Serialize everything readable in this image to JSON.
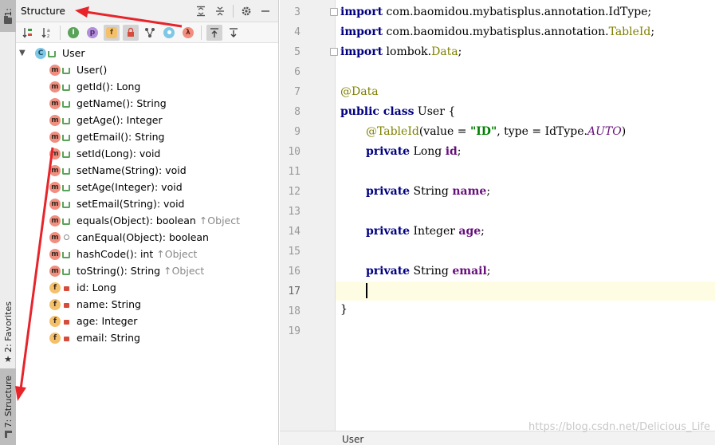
{
  "side_strip": {
    "project_tab": "1:",
    "favorites_tab": "2: Favorites",
    "structure_tab": "7: Structure"
  },
  "structure_panel": {
    "title": "Structure",
    "toolbar_icons": [
      "sort-visibility-icon",
      "sort-alpha-icon",
      "show-inherited-icon",
      "show-properties-icon",
      "show-fields-icon",
      "show-non-public-icon",
      "show-lambdas-icon",
      "autoscroll-to-source-icon",
      "autoscroll-from-source-icon"
    ],
    "root": "User",
    "members": [
      {
        "kind": "m",
        "vis": "public",
        "name": "User()",
        "override": ""
      },
      {
        "kind": "m",
        "vis": "public",
        "name": "getId(): Long",
        "override": ""
      },
      {
        "kind": "m",
        "vis": "public",
        "name": "getName(): String",
        "override": ""
      },
      {
        "kind": "m",
        "vis": "public",
        "name": "getAge(): Integer",
        "override": ""
      },
      {
        "kind": "m",
        "vis": "public",
        "name": "getEmail(): String",
        "override": ""
      },
      {
        "kind": "m",
        "vis": "public",
        "name": "setId(Long): void",
        "override": ""
      },
      {
        "kind": "m",
        "vis": "public",
        "name": "setName(String): void",
        "override": ""
      },
      {
        "kind": "m",
        "vis": "public",
        "name": "setAge(Integer): void",
        "override": ""
      },
      {
        "kind": "m",
        "vis": "public",
        "name": "setEmail(String): void",
        "override": ""
      },
      {
        "kind": "m",
        "vis": "public",
        "name": "equals(Object): boolean",
        "override": "↑Object"
      },
      {
        "kind": "m",
        "vis": "package",
        "name": "canEqual(Object): boolean",
        "override": ""
      },
      {
        "kind": "m",
        "vis": "public",
        "name": "hashCode(): int",
        "override": "↑Object"
      },
      {
        "kind": "m",
        "vis": "public",
        "name": "toString(): String",
        "override": "↑Object"
      },
      {
        "kind": "f",
        "vis": "private",
        "name": "id: Long",
        "override": ""
      },
      {
        "kind": "f",
        "vis": "private",
        "name": "name: String",
        "override": ""
      },
      {
        "kind": "f",
        "vis": "private",
        "name": "age: Integer",
        "override": ""
      },
      {
        "kind": "f",
        "vis": "private",
        "name": "email: String",
        "override": ""
      }
    ]
  },
  "editor": {
    "line_numbers": [
      "3",
      "4",
      "5",
      "6",
      "7",
      "8",
      "9",
      "10",
      "11",
      "12",
      "13",
      "14",
      "15",
      "16",
      "17",
      "18",
      "19"
    ],
    "current_line": "17",
    "code": {
      "l3_kw": "import",
      "l3_rest": " com.baomidou.mybatisplus.annotation.IdType;",
      "l4_kw": "import",
      "l4_pkg": " com.baomidou.mybatisplus.annotation.",
      "l4_cls": "TableId",
      "l4_end": ";",
      "l5_kw": "import",
      "l5_pkg": " lombok.",
      "l5_cls": "Data",
      "l5_end": ";",
      "l7_ann": "@Data",
      "l8_kw": "public class",
      "l8_rest": " User {",
      "l9_ann": "@TableId",
      "l9_a": "(value = ",
      "l9_str": "\"ID\"",
      "l9_b": ", type = IdType.",
      "l9_enum": "AUTO",
      "l9_c": ")",
      "l10_kw": "private",
      "l10_type": " Long ",
      "l10_fld": "id",
      "l10_end": ";",
      "l12_kw": "private",
      "l12_type": " String ",
      "l12_fld": "name",
      "l12_end": ";",
      "l14_kw": "private",
      "l14_type": " Integer ",
      "l14_fld": "age",
      "l14_end": ";",
      "l16_kw": "private",
      "l16_type": " String ",
      "l16_fld": "email",
      "l16_end": ";",
      "l18": "}"
    },
    "breadcrumb": "User"
  },
  "watermark": "https://blog.csdn.net/Delicious_Life",
  "colors": {
    "keyword": "#000080",
    "annotation": "#808000",
    "string": "#008000",
    "field": "#660e7a",
    "arrow": "#e8242b"
  }
}
